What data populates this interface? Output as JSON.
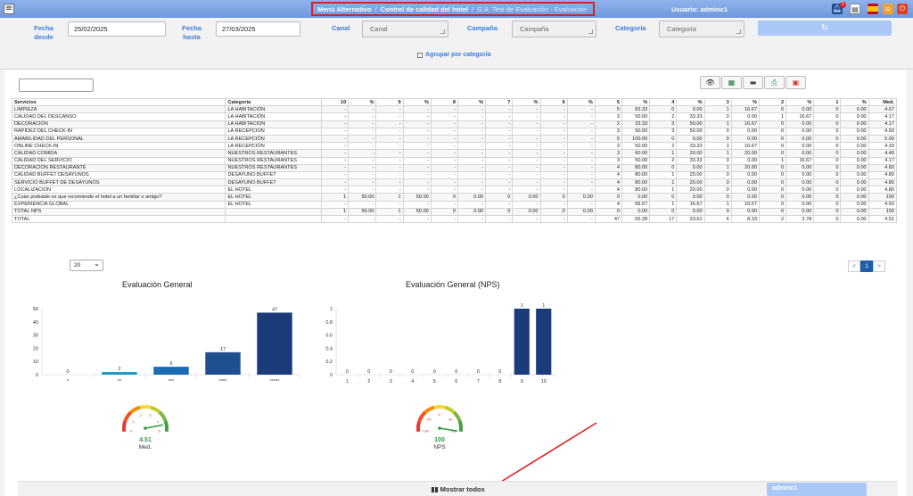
{
  "header": {
    "menu_icon": "hamburger-icon",
    "breadcrumb": [
      "Menú Alternativo",
      "Control de calidad del hotel",
      "G.A. Test de Evaluación - Evaluación"
    ],
    "user": "Usuario: adminc1",
    "notifications": "1",
    "icons": [
      "bell-icon",
      "document-icon",
      "spain-flag-icon",
      "home-icon",
      "power-icon"
    ]
  },
  "filters": {
    "date_from_label": "Fecha desde",
    "date_from": "25/02/2025",
    "date_to_label": "Fecha hasta",
    "date_to": "27/03/2025",
    "channel_label": "Canal",
    "channel_placeholder": "Canal",
    "campaign_label": "Campaña",
    "campaign_placeholder": "Campaña",
    "category_label": "Categoría",
    "category_placeholder": "Categoría",
    "refresh_icon": "refresh-icon",
    "group_label": "Agrupar por categoría"
  },
  "toolbar": {
    "icons": [
      "eye-icon",
      "excel-icon",
      "print-icon",
      "printer-alt-icon",
      "pdf-icon"
    ]
  },
  "table": {
    "headers": [
      "Servicios",
      "Categoría",
      "10",
      "%",
      "9",
      "%",
      "8",
      "%",
      "7",
      "%",
      "6",
      "%",
      "5",
      "%",
      "4",
      "%",
      "3",
      "%",
      "2",
      "%",
      "1",
      "%",
      "Med."
    ],
    "rows": [
      [
        "LIMPIEZA",
        "LA HABITACIÓN",
        "-",
        "-",
        "-",
        "-",
        "-",
        "-",
        "-",
        "-",
        "-",
        "-",
        "5",
        "83.33",
        "0",
        "0.00",
        "1",
        "16.67",
        "0",
        "0.00",
        "0",
        "0.00",
        "4.67"
      ],
      [
        "CALIDAD DEL DESCANSO",
        "LA HABITACIÓN",
        "-",
        "-",
        "-",
        "-",
        "-",
        "-",
        "-",
        "-",
        "-",
        "-",
        "3",
        "50.00",
        "2",
        "33.33",
        "0",
        "0.00",
        "1",
        "16.67",
        "0",
        "0.00",
        "4.17"
      ],
      [
        "DECORACIÓN",
        "LA HABITACIÓN",
        "-",
        "-",
        "-",
        "-",
        "-",
        "-",
        "-",
        "-",
        "-",
        "-",
        "2",
        "33.33",
        "3",
        "50.00",
        "1",
        "16.67",
        "0",
        "0.00",
        "0",
        "0.00",
        "4.17"
      ],
      [
        "RAPIDEZ DEL CHECK-IN",
        "LA RECEPCIÓN",
        "-",
        "-",
        "-",
        "-",
        "-",
        "-",
        "-",
        "-",
        "-",
        "-",
        "3",
        "50.00",
        "3",
        "50.00",
        "0",
        "0.00",
        "0",
        "0.00",
        "0",
        "0.00",
        "4.50"
      ],
      [
        "AMABILIDAD DEL PERSONAL",
        "LA RECEPCIÓN",
        "-",
        "-",
        "-",
        "-",
        "-",
        "-",
        "-",
        "-",
        "-",
        "-",
        "5",
        "100.00",
        "0",
        "0.00",
        "0",
        "0.00",
        "0",
        "0.00",
        "0",
        "0.00",
        "5.00"
      ],
      [
        "ONLINE CHECK-IN",
        "LA RECEPCIÓN",
        "-",
        "-",
        "-",
        "-",
        "-",
        "-",
        "-",
        "-",
        "-",
        "-",
        "3",
        "50.00",
        "2",
        "33.33",
        "1",
        "16.67",
        "0",
        "0.00",
        "0",
        "0.00",
        "4.33"
      ],
      [
        "CALIDAD COMIDA",
        "NUESTROS RESTAURANTES",
        "-",
        "-",
        "-",
        "-",
        "-",
        "-",
        "-",
        "-",
        "-",
        "-",
        "3",
        "60.00",
        "1",
        "20.00",
        "1",
        "20.00",
        "0",
        "0.00",
        "0",
        "0.00",
        "4.40"
      ],
      [
        "CALIDAD DEL SERVICIO",
        "NUESTROS RESTAURANTES",
        "-",
        "-",
        "-",
        "-",
        "-",
        "-",
        "-",
        "-",
        "-",
        "-",
        "3",
        "50.00",
        "2",
        "33.33",
        "0",
        "0.00",
        "1",
        "16.67",
        "0",
        "0.00",
        "4.17"
      ],
      [
        "DECORACIÓN RESTAURANTE",
        "NUESTROS RESTAURANTES",
        "-",
        "-",
        "-",
        "-",
        "-",
        "-",
        "-",
        "-",
        "-",
        "-",
        "4",
        "80.00",
        "0",
        "0.00",
        "1",
        "20.00",
        "0",
        "0.00",
        "0",
        "0.00",
        "4.60"
      ],
      [
        "CALIDAD BUFFET DESAYUNOS",
        "DESAYUNO BUFFET",
        "-",
        "-",
        "-",
        "-",
        "-",
        "-",
        "-",
        "-",
        "-",
        "-",
        "4",
        "80.00",
        "1",
        "20.00",
        "0",
        "0.00",
        "0",
        "0.00",
        "0",
        "0.00",
        "4.80"
      ],
      [
        "SERVICIO BUFFET DE DESAYUNOS",
        "DESAYUNO BUFFET",
        "-",
        "-",
        "-",
        "-",
        "-",
        "-",
        "-",
        "-",
        "-",
        "-",
        "4",
        "80.00",
        "1",
        "20.00",
        "0",
        "0.00",
        "0",
        "0.00",
        "0",
        "0.00",
        "4.80"
      ],
      [
        "LOCALIZACION",
        "EL HOTEL",
        "-",
        "-",
        "-",
        "-",
        "-",
        "-",
        "-",
        "-",
        "-",
        "-",
        "4",
        "80.00",
        "1",
        "20.00",
        "0",
        "0.00",
        "0",
        "0.00",
        "0",
        "0.00",
        "4.80"
      ],
      [
        "¿Cuán probable es que recomiende el hotel a un familiar o amigo?",
        "EL HOTEL",
        "1",
        "50.00",
        "1",
        "50.00",
        "0",
        "0.00",
        "0",
        "0.00",
        "0",
        "0.00",
        "0",
        "0.00",
        "0",
        "0.00",
        "0",
        "0.00",
        "0",
        "0.00",
        "0",
        "0.00",
        "100"
      ],
      [
        "EXPERIENCIA GLOBAL",
        "EL HOTEL",
        "-",
        "-",
        "-",
        "-",
        "-",
        "-",
        "-",
        "-",
        "-",
        "-",
        "4",
        "66.67",
        "1",
        "16.67",
        "1",
        "16.67",
        "0",
        "0.00",
        "0",
        "0.00",
        "4.50"
      ],
      [
        "TOTAL NPS",
        "",
        "1",
        "50.00",
        "1",
        "50.00",
        "0",
        "0.00",
        "0",
        "0.00",
        "0",
        "0.00",
        "0",
        "0.00",
        "0",
        "0.00",
        "0",
        "0.00",
        "0",
        "0.00",
        "0",
        "0.00",
        "100"
      ],
      [
        "TOTAL",
        "",
        "-",
        "-",
        "-",
        "-",
        "-",
        "-",
        "-",
        "-",
        "-",
        "-",
        "47",
        "65.28",
        "17",
        "23.61",
        "6",
        "8.33",
        "2",
        "2.78",
        "0",
        "0.00",
        "4.51"
      ]
    ]
  },
  "pagination": {
    "page_size": "20",
    "prev": "<",
    "current": "1",
    "next": ">"
  },
  "chart_data": [
    {
      "type": "bar",
      "title": "Evaluación General",
      "categories": [
        "*",
        "**",
        "***",
        "****",
        "*****"
      ],
      "values": [
        0,
        2,
        6,
        17,
        47
      ],
      "yticks": [
        0,
        10,
        20,
        30,
        40,
        50
      ],
      "ylim": [
        0,
        50
      ],
      "colors": [
        "#1b9bc4",
        "#1b9bc4",
        "#1a6db3",
        "#1f4f8f",
        "#1b3c7a"
      ]
    },
    {
      "type": "bar",
      "title": "Evaluación General (NPS)",
      "categories": [
        "1",
        "2",
        "3",
        "4",
        "5",
        "6",
        "7",
        "8",
        "9",
        "10"
      ],
      "values": [
        0,
        0,
        0,
        0,
        0,
        0,
        0,
        0,
        1,
        1
      ],
      "yticks": [
        0,
        0.2,
        0.4,
        0.6,
        0.8,
        1
      ],
      "yticklabels": [
        "0",
        "0.2",
        "0.4",
        "0.6",
        "0.8",
        "1"
      ],
      "ylim": [
        0,
        1
      ],
      "color": "#1b3c7a"
    }
  ],
  "gauges": [
    {
      "value": 4.51,
      "value_label": "4.51",
      "caption": "Med.",
      "min": 0,
      "max": 5,
      "ticks": [
        "0",
        "1",
        "2",
        "3",
        "4",
        "5"
      ]
    },
    {
      "value": 100,
      "value_label": "100",
      "caption": "NPS",
      "min": -100,
      "max": 100,
      "ticks": [
        "-100",
        "-50",
        "0",
        "50",
        "100"
      ]
    }
  ],
  "footer": {
    "show_all_icon": "bar-chart-icon",
    "show_all": "Mostrar todos",
    "user": "adminc1"
  }
}
